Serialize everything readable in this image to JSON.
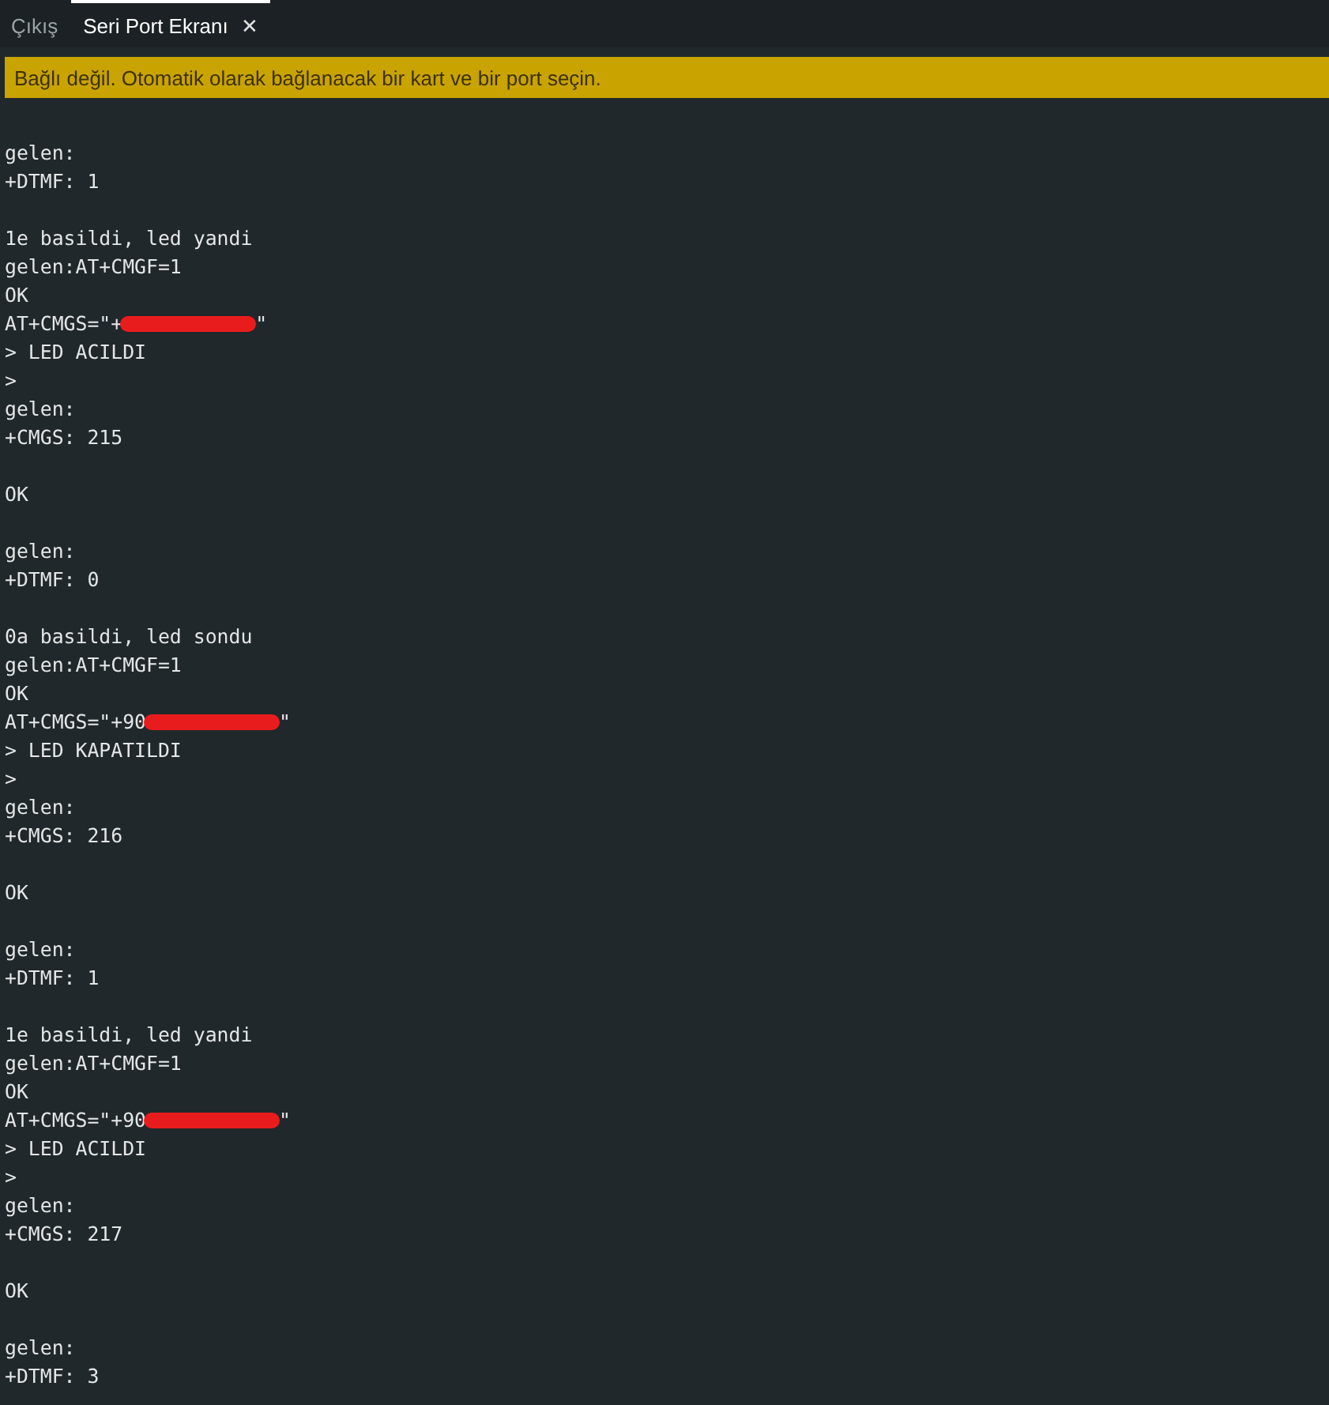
{
  "tabs": [
    {
      "label": "Çıkış",
      "selected": false
    },
    {
      "label": "Seri Port Ekranı",
      "selected": true,
      "close": "✕"
    }
  ],
  "banner": {
    "text": "Bağlı değil. Otomatik olarak bağlanacak bir kart ve bir port seçin."
  },
  "output_blocks": [
    [
      {
        "text": "gelen:"
      },
      {
        "text": "+DTMF: 1"
      }
    ],
    [
      {
        "text": "1e basildi, led yandi"
      },
      {
        "text": "gelen:AT+CMGF=1"
      },
      {
        "text": "OK"
      },
      {
        "kind": "redacted",
        "before": "AT+CMGS=\"+",
        "after": "\""
      },
      {
        "text": "> LED ACILDI"
      },
      {
        "text": ">"
      },
      {
        "text": "gelen:"
      },
      {
        "text": "+CMGS: 215"
      }
    ],
    [
      {
        "text": "OK"
      }
    ],
    [
      {
        "text": "gelen:"
      },
      {
        "text": "+DTMF: 0"
      }
    ],
    [
      {
        "text": "0a basildi, led sondu"
      },
      {
        "text": "gelen:AT+CMGF=1"
      },
      {
        "text": "OK"
      },
      {
        "kind": "redacted",
        "before": "AT+CMGS=\"+90",
        "after": "\""
      },
      {
        "text": "> LED KAPATILDI"
      },
      {
        "text": ">"
      },
      {
        "text": "gelen:"
      },
      {
        "text": "+CMGS: 216"
      }
    ],
    [
      {
        "text": "OK"
      }
    ],
    [
      {
        "text": "gelen:"
      },
      {
        "text": "+DTMF: 1"
      }
    ],
    [
      {
        "text": "1e basildi, led yandi"
      },
      {
        "text": "gelen:AT+CMGF=1"
      },
      {
        "text": "OK"
      },
      {
        "kind": "redacted",
        "before": "AT+CMGS=\"+90",
        "after": "\""
      },
      {
        "text": "> LED ACILDI"
      },
      {
        "text": ">"
      },
      {
        "text": "gelen:"
      },
      {
        "text": "+CMGS: 217"
      }
    ],
    [
      {
        "text": "OK"
      }
    ],
    [
      {
        "text": "gelen:"
      },
      {
        "text": "+DTMF: 3"
      }
    ]
  ]
}
